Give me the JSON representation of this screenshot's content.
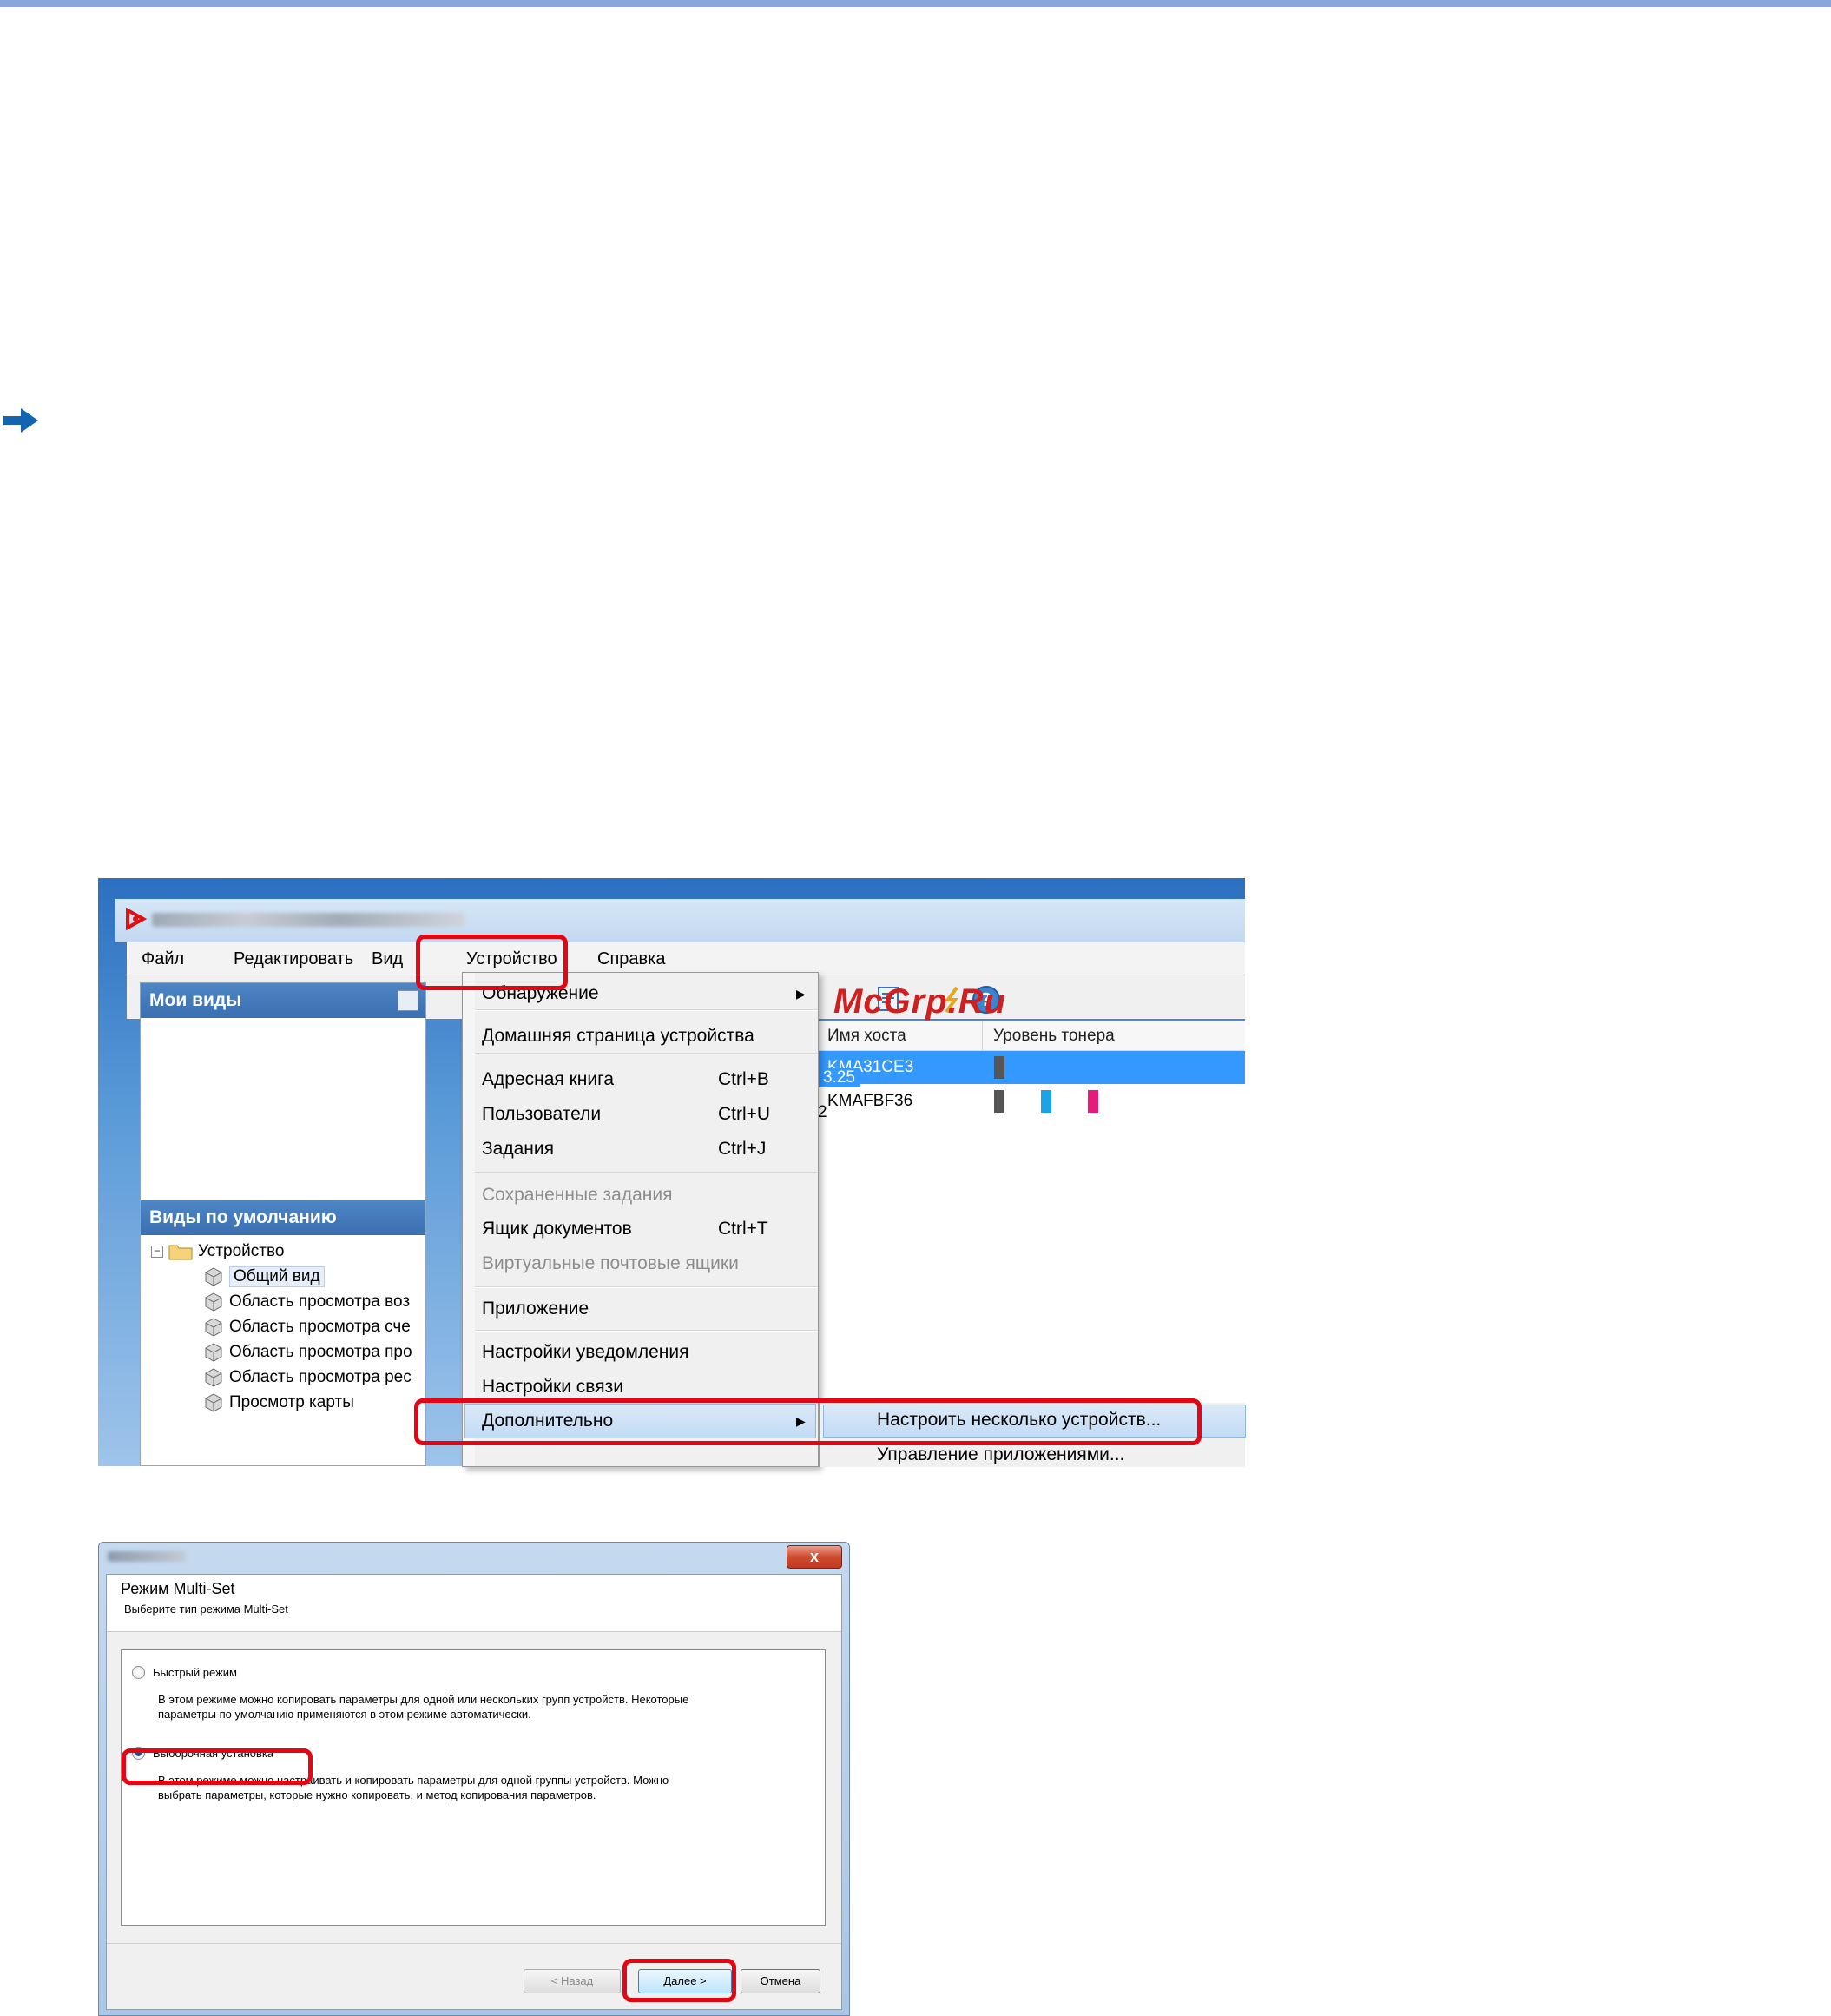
{
  "colors": {
    "accent_red": "#e40613",
    "selection_blue": "#3399ff",
    "pane_header": "#3a6fb0"
  },
  "watermark": "McGrp.Ru",
  "main_window": {
    "menu": [
      "Файл",
      "Редактировать",
      "Вид",
      "Устройство",
      "Справка"
    ],
    "left_pane": {
      "my_views_title": "Мои виды",
      "default_views_title": "Виды по умолчанию",
      "tree_root": "Устройство",
      "tree_items": [
        "Общий вид",
        "Область просмотра воз",
        "Область просмотра сче",
        "Область просмотра про",
        "Область просмотра рес",
        "Просмотр карты"
      ]
    },
    "grid": {
      "columns": [
        "Имя хоста",
        "Уровень тонера"
      ],
      "rows": [
        {
          "ip_fragment": "3.25",
          "host": "KMA31CE3",
          "toner": [
            "#555555"
          ]
        },
        {
          "ip_fragment": "2",
          "host": "KMAFBF36",
          "toner": [
            "#555555",
            "#1aa3e6",
            "#e6197d"
          ]
        }
      ]
    },
    "dropdown": {
      "discovery": "Обнаружение",
      "home_page": "Домашняя страница устройства",
      "address_book": {
        "label": "Адресная книга",
        "shortcut": "Ctrl+B"
      },
      "users": {
        "label": "Пользователи",
        "shortcut": "Ctrl+U"
      },
      "jobs": {
        "label": "Задания",
        "shortcut": "Ctrl+J"
      },
      "saved_jobs": "Сохраненные задания",
      "document_box": {
        "label": "Ящик документов",
        "shortcut": "Ctrl+T"
      },
      "virtual_mailboxes": "Виртуальные почтовые ящики",
      "application": "Приложение",
      "notification_settings": "Настройки уведомления",
      "communication_settings": "Настройки связи",
      "advanced": "Дополнительно"
    },
    "submenu": {
      "multi_device": "Настроить несколько устройств...",
      "app_management": "Управление приложениями..."
    }
  },
  "dialog": {
    "close_glyph": "x",
    "title": "Режим Multi-Set",
    "subtitle": "Выберите тип режима Multi-Set",
    "options": [
      {
        "label": "Быстрый режим",
        "checked": false,
        "desc_line1": "В этом режиме можно копировать параметры для одной или нескольких групп устройств. Некоторые",
        "desc_line2": "параметры по умолчанию применяются в этом режиме автоматически."
      },
      {
        "label": "Выборочная установка",
        "checked": true,
        "desc_line1": "В этом режиме можно настраивать и копировать параметры для одной группы устройств. Можно",
        "desc_line2": "выбрать параметры, которые нужно копировать, и метод копирования параметров."
      }
    ],
    "buttons": {
      "back": "< Назад",
      "next": "Далее >",
      "cancel": "Отмена"
    }
  }
}
